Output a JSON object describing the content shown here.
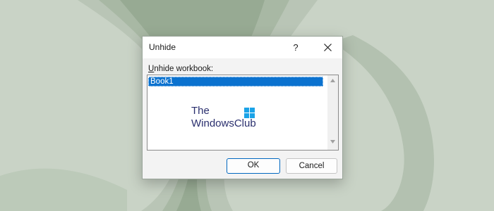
{
  "dialog": {
    "title": "Unhide",
    "help_glyph": "?",
    "close_icon": "close-icon",
    "field_label": "Unhide workbook:",
    "workbooks": [
      "Book1"
    ],
    "selected_workbook": "Book1",
    "ok_label": "OK",
    "cancel_label": "Cancel"
  },
  "watermark": {
    "line1": "The",
    "line2": "WindowsClub",
    "logo_icon": "windows-logo-icon"
  },
  "colors": {
    "accent": "#0067c0",
    "selection": "#0b72cf",
    "wallpaper": "#c9d3c6"
  }
}
